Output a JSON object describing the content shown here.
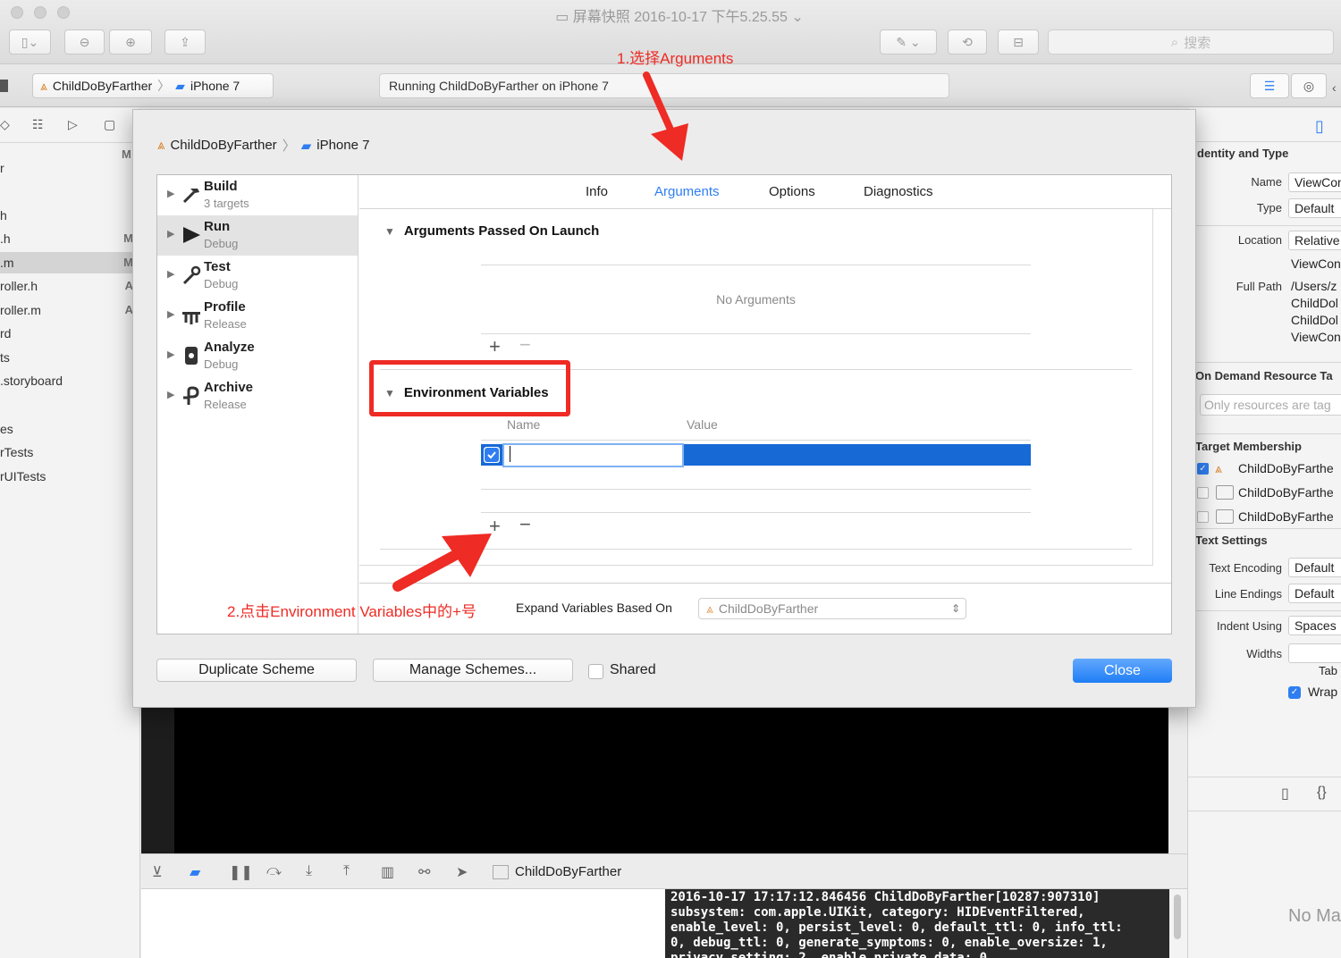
{
  "window": {
    "title": "屏幕快照 2016-10-17 下午5.25.55"
  },
  "toolbar": {
    "search_placeholder": "搜索"
  },
  "scheme": {
    "project": "ChildDoByFarther",
    "device": "iPhone 7"
  },
  "activity": {
    "status": "Running ChildDoByFarther on iPhone 7"
  },
  "navigator": {
    "items": [
      {
        "label": "r",
        "badge": ""
      },
      {
        "label": "",
        "badge": ""
      },
      {
        "label": "h",
        "badge": ""
      },
      {
        "label": ".h",
        "badge": "M"
      },
      {
        "label": ".m",
        "badge": "M"
      },
      {
        "label": "roller.h",
        "badge": "A"
      },
      {
        "label": "roller.m",
        "badge": "A"
      },
      {
        "label": "rd",
        "badge": ""
      },
      {
        "label": "ts",
        "badge": ""
      },
      {
        "label": ".storyboard",
        "badge": ""
      },
      {
        "label": "es",
        "badge": ""
      },
      {
        "label": "rTests",
        "badge": ""
      },
      {
        "label": "rUITests",
        "badge": ""
      }
    ],
    "header_badge": "M"
  },
  "inspector": {
    "identity_title": "dentity and Type",
    "name_label": "Name",
    "name_value": "ViewCon",
    "type_label": "Type",
    "type_value": "Default",
    "location_label": "Location",
    "location_value": "Relative",
    "location_file": "ViewCon",
    "fullpath_label": "Full Path",
    "fullpath_lines": [
      "/Users/z",
      "ChildDol",
      "ChildDol",
      "ViewCon"
    ],
    "odr_title": "On Demand Resource Ta",
    "odr_placeholder": "Only resources are tag",
    "membership_title": "Target Membership",
    "membership": [
      {
        "label": "ChildDoByFarthe",
        "checked": true
      },
      {
        "label": "ChildDoByFarthe",
        "checked": false
      },
      {
        "label": "ChildDoByFarthe",
        "checked": false
      }
    ],
    "text_title": "Text Settings",
    "encoding_label": "Text Encoding",
    "encoding_value": "Default",
    "endings_label": "Line Endings",
    "endings_value": "Default",
    "indent_label": "Indent Using",
    "indent_value": "Spaces",
    "widths_label": "Widths",
    "tab_label": "Tab",
    "wrap_label": "Wrap",
    "no_matches": "No Ma"
  },
  "sheet": {
    "breadcrumb_project": "ChildDoByFarther",
    "breadcrumb_device": "iPhone 7",
    "actions": [
      {
        "name": "Build",
        "sub": "3 targets"
      },
      {
        "name": "Run",
        "sub": "Debug"
      },
      {
        "name": "Test",
        "sub": "Debug"
      },
      {
        "name": "Profile",
        "sub": "Release"
      },
      {
        "name": "Analyze",
        "sub": "Debug"
      },
      {
        "name": "Archive",
        "sub": "Release"
      }
    ],
    "tabs": {
      "info": "Info",
      "arguments": "Arguments",
      "options": "Options",
      "diagnostics": "Diagnostics"
    },
    "args_title": "Arguments Passed On Launch",
    "no_args": "No Arguments",
    "env_title": "Environment Variables",
    "env_col_name": "Name",
    "env_col_value": "Value",
    "expand_label": "Expand Variables Based On",
    "expand_value": "ChildDoByFarther",
    "buttons": {
      "duplicate": "Duplicate Scheme",
      "manage": "Manage Schemes...",
      "shared": "Shared",
      "close": "Close"
    },
    "accent": "#2e7ef2"
  },
  "debug": {
    "target": "ChildDoByFarther",
    "log": "2016-10-17 17:17:12.846456 ChildDoByFarther[10287:907310]\nsubsystem: com.apple.UIKit, category: HIDEventFiltered,\nenable_level: 0, persist_level: 0, default_ttl: 0, info_ttl:\n0, debug_ttl: 0, generate_symptoms: 0, enable_oversize: 1,\nprivacy_setting: 2, enable_private_data: 0"
  },
  "annotations": {
    "step1": "1.选择Arguments",
    "step2": "2.点击Environment Variables中的+号",
    "color": "#ee2b24"
  }
}
